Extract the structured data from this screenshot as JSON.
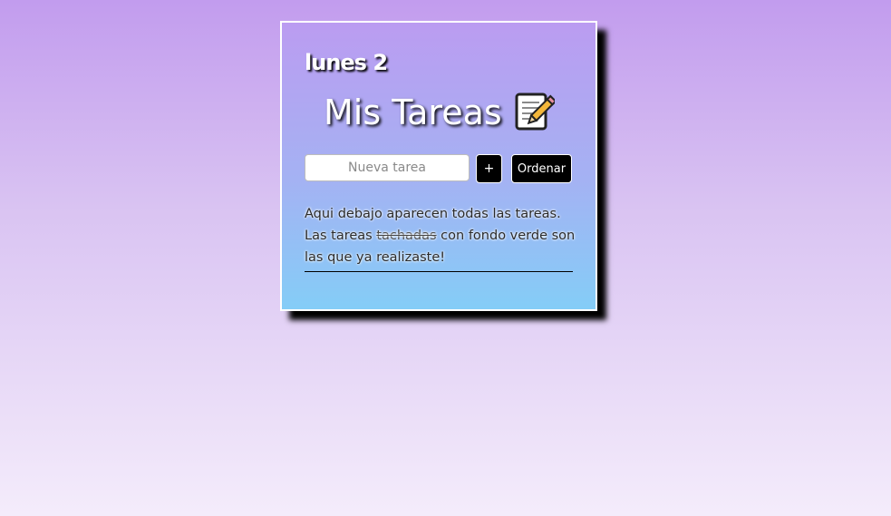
{
  "card": {
    "date_label": "lunes 2",
    "title": "Mis Tareas",
    "title_icon": "memo-icon",
    "new_task_input": {
      "placeholder": "Nueva tarea",
      "value": ""
    },
    "add_button_label": "+",
    "sort_button_label": "Ordenar",
    "info": {
      "line1": "Aqui debajo aparecen todas las tareas.",
      "before_strike": "Las tareas ",
      "strike_word": "tachadas",
      "after_strike": " con fondo verde son las que ya realizaste!"
    }
  },
  "colors": {
    "page_background_top": "#c29cee",
    "page_background_bottom": "#f4ecfb",
    "card_gradient_top": "#bb9cf1",
    "card_gradient_bottom": "#84cdf7",
    "button_background": "#000000",
    "button_text": "#ffffff"
  }
}
